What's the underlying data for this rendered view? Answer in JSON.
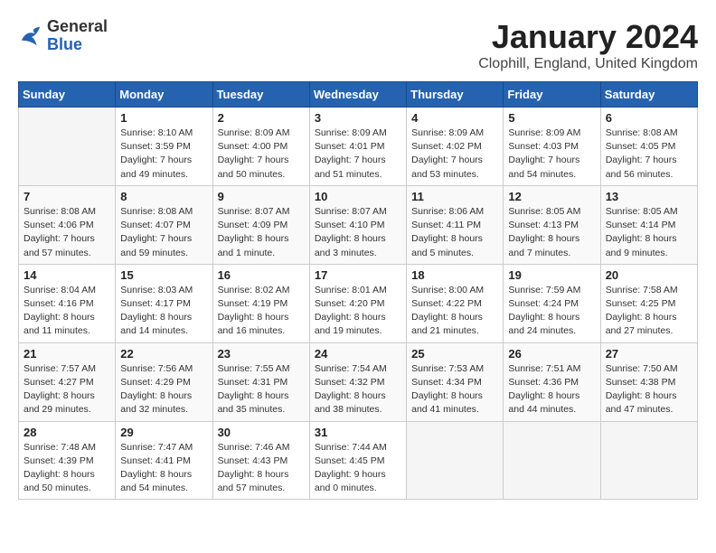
{
  "header": {
    "logo_general": "General",
    "logo_blue": "Blue",
    "title": "January 2024",
    "subtitle": "Clophill, England, United Kingdom"
  },
  "days_of_week": [
    "Sunday",
    "Monday",
    "Tuesday",
    "Wednesday",
    "Thursday",
    "Friday",
    "Saturday"
  ],
  "weeks": [
    [
      {
        "day": "",
        "sunrise": "",
        "sunset": "",
        "daylight": ""
      },
      {
        "day": "1",
        "sunrise": "Sunrise: 8:10 AM",
        "sunset": "Sunset: 3:59 PM",
        "daylight": "Daylight: 7 hours and 49 minutes."
      },
      {
        "day": "2",
        "sunrise": "Sunrise: 8:09 AM",
        "sunset": "Sunset: 4:00 PM",
        "daylight": "Daylight: 7 hours and 50 minutes."
      },
      {
        "day": "3",
        "sunrise": "Sunrise: 8:09 AM",
        "sunset": "Sunset: 4:01 PM",
        "daylight": "Daylight: 7 hours and 51 minutes."
      },
      {
        "day": "4",
        "sunrise": "Sunrise: 8:09 AM",
        "sunset": "Sunset: 4:02 PM",
        "daylight": "Daylight: 7 hours and 53 minutes."
      },
      {
        "day": "5",
        "sunrise": "Sunrise: 8:09 AM",
        "sunset": "Sunset: 4:03 PM",
        "daylight": "Daylight: 7 hours and 54 minutes."
      },
      {
        "day": "6",
        "sunrise": "Sunrise: 8:08 AM",
        "sunset": "Sunset: 4:05 PM",
        "daylight": "Daylight: 7 hours and 56 minutes."
      }
    ],
    [
      {
        "day": "7",
        "sunrise": "Sunrise: 8:08 AM",
        "sunset": "Sunset: 4:06 PM",
        "daylight": "Daylight: 7 hours and 57 minutes."
      },
      {
        "day": "8",
        "sunrise": "Sunrise: 8:08 AM",
        "sunset": "Sunset: 4:07 PM",
        "daylight": "Daylight: 7 hours and 59 minutes."
      },
      {
        "day": "9",
        "sunrise": "Sunrise: 8:07 AM",
        "sunset": "Sunset: 4:09 PM",
        "daylight": "Daylight: 8 hours and 1 minute."
      },
      {
        "day": "10",
        "sunrise": "Sunrise: 8:07 AM",
        "sunset": "Sunset: 4:10 PM",
        "daylight": "Daylight: 8 hours and 3 minutes."
      },
      {
        "day": "11",
        "sunrise": "Sunrise: 8:06 AM",
        "sunset": "Sunset: 4:11 PM",
        "daylight": "Daylight: 8 hours and 5 minutes."
      },
      {
        "day": "12",
        "sunrise": "Sunrise: 8:05 AM",
        "sunset": "Sunset: 4:13 PM",
        "daylight": "Daylight: 8 hours and 7 minutes."
      },
      {
        "day": "13",
        "sunrise": "Sunrise: 8:05 AM",
        "sunset": "Sunset: 4:14 PM",
        "daylight": "Daylight: 8 hours and 9 minutes."
      }
    ],
    [
      {
        "day": "14",
        "sunrise": "Sunrise: 8:04 AM",
        "sunset": "Sunset: 4:16 PM",
        "daylight": "Daylight: 8 hours and 11 minutes."
      },
      {
        "day": "15",
        "sunrise": "Sunrise: 8:03 AM",
        "sunset": "Sunset: 4:17 PM",
        "daylight": "Daylight: 8 hours and 14 minutes."
      },
      {
        "day": "16",
        "sunrise": "Sunrise: 8:02 AM",
        "sunset": "Sunset: 4:19 PM",
        "daylight": "Daylight: 8 hours and 16 minutes."
      },
      {
        "day": "17",
        "sunrise": "Sunrise: 8:01 AM",
        "sunset": "Sunset: 4:20 PM",
        "daylight": "Daylight: 8 hours and 19 minutes."
      },
      {
        "day": "18",
        "sunrise": "Sunrise: 8:00 AM",
        "sunset": "Sunset: 4:22 PM",
        "daylight": "Daylight: 8 hours and 21 minutes."
      },
      {
        "day": "19",
        "sunrise": "Sunrise: 7:59 AM",
        "sunset": "Sunset: 4:24 PM",
        "daylight": "Daylight: 8 hours and 24 minutes."
      },
      {
        "day": "20",
        "sunrise": "Sunrise: 7:58 AM",
        "sunset": "Sunset: 4:25 PM",
        "daylight": "Daylight: 8 hours and 27 minutes."
      }
    ],
    [
      {
        "day": "21",
        "sunrise": "Sunrise: 7:57 AM",
        "sunset": "Sunset: 4:27 PM",
        "daylight": "Daylight: 8 hours and 29 minutes."
      },
      {
        "day": "22",
        "sunrise": "Sunrise: 7:56 AM",
        "sunset": "Sunset: 4:29 PM",
        "daylight": "Daylight: 8 hours and 32 minutes."
      },
      {
        "day": "23",
        "sunrise": "Sunrise: 7:55 AM",
        "sunset": "Sunset: 4:31 PM",
        "daylight": "Daylight: 8 hours and 35 minutes."
      },
      {
        "day": "24",
        "sunrise": "Sunrise: 7:54 AM",
        "sunset": "Sunset: 4:32 PM",
        "daylight": "Daylight: 8 hours and 38 minutes."
      },
      {
        "day": "25",
        "sunrise": "Sunrise: 7:53 AM",
        "sunset": "Sunset: 4:34 PM",
        "daylight": "Daylight: 8 hours and 41 minutes."
      },
      {
        "day": "26",
        "sunrise": "Sunrise: 7:51 AM",
        "sunset": "Sunset: 4:36 PM",
        "daylight": "Daylight: 8 hours and 44 minutes."
      },
      {
        "day": "27",
        "sunrise": "Sunrise: 7:50 AM",
        "sunset": "Sunset: 4:38 PM",
        "daylight": "Daylight: 8 hours and 47 minutes."
      }
    ],
    [
      {
        "day": "28",
        "sunrise": "Sunrise: 7:48 AM",
        "sunset": "Sunset: 4:39 PM",
        "daylight": "Daylight: 8 hours and 50 minutes."
      },
      {
        "day": "29",
        "sunrise": "Sunrise: 7:47 AM",
        "sunset": "Sunset: 4:41 PM",
        "daylight": "Daylight: 8 hours and 54 minutes."
      },
      {
        "day": "30",
        "sunrise": "Sunrise: 7:46 AM",
        "sunset": "Sunset: 4:43 PM",
        "daylight": "Daylight: 8 hours and 57 minutes."
      },
      {
        "day": "31",
        "sunrise": "Sunrise: 7:44 AM",
        "sunset": "Sunset: 4:45 PM",
        "daylight": "Daylight: 9 hours and 0 minutes."
      },
      {
        "day": "",
        "sunrise": "",
        "sunset": "",
        "daylight": ""
      },
      {
        "day": "",
        "sunrise": "",
        "sunset": "",
        "daylight": ""
      },
      {
        "day": "",
        "sunrise": "",
        "sunset": "",
        "daylight": ""
      }
    ]
  ]
}
